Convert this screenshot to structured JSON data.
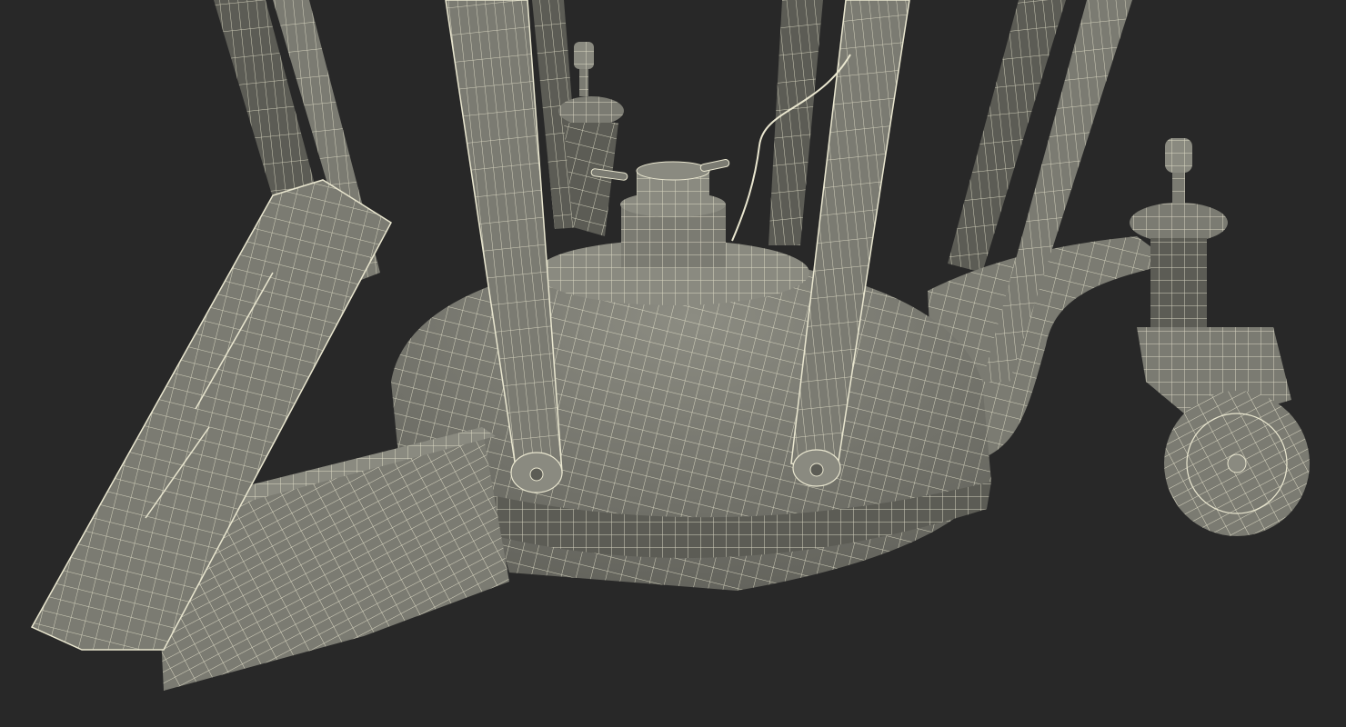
{
  "scene": {
    "subject": "wireframe-render",
    "colors": {
      "background": "#282828",
      "surface": "#7b7b72",
      "surface_light": "#8a8a80",
      "surface_dark": "#5c5c55",
      "shadow": "#45453f",
      "wire": "#eae7d0"
    }
  }
}
